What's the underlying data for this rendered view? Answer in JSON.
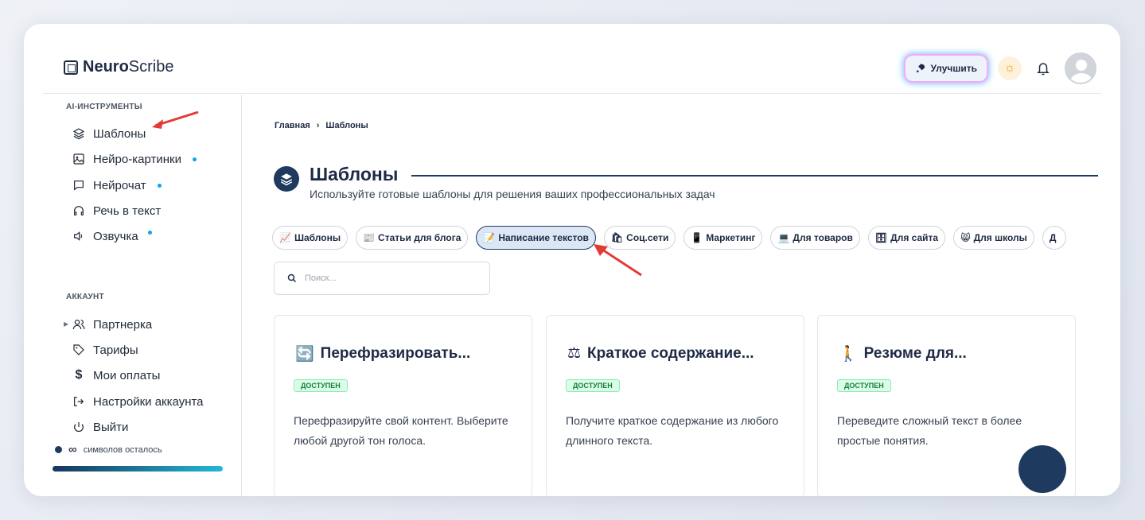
{
  "app": {
    "brand_bold": "Neuro",
    "brand_rest": "Scribe"
  },
  "header": {
    "upgrade_label": "Улучшить"
  },
  "sidebar": {
    "sections": [
      {
        "title": "AI-ИНСТРУМЕНТЫ",
        "items": [
          {
            "label": "Шаблоны",
            "icon": "layers-icon"
          },
          {
            "label": "Нейро-картинки",
            "icon": "image-icon",
            "dot": true
          },
          {
            "label": "Нейрочат",
            "icon": "chat-icon",
            "dot": true
          },
          {
            "label": "Речь в текст",
            "icon": "headphones-icon"
          },
          {
            "label": "Озвучка",
            "icon": "speaker-icon",
            "dot": true
          }
        ]
      },
      {
        "title": "АККАУНТ",
        "items": [
          {
            "label": "Партнерка",
            "icon": "users-icon"
          },
          {
            "label": "Тарифы",
            "icon": "tag-icon"
          },
          {
            "label": "Мои оплаты",
            "icon": "dollar-icon"
          },
          {
            "label": "Настройки аккаунта",
            "icon": "logout-arrow-icon"
          },
          {
            "label": "Выйти",
            "icon": "power-icon"
          }
        ]
      }
    ],
    "chars_infinity": "∞",
    "chars_label": "символов осталось"
  },
  "main": {
    "breadcrumb": [
      "Главная",
      "Шаблоны"
    ],
    "title": "Шаблоны",
    "subtitle": "Используйте готовые шаблоны для решения ваших профессиональных задач",
    "chips": [
      {
        "emoji": "📈",
        "label": "Шаблоны"
      },
      {
        "emoji": "📰",
        "label": "Статьи для блога"
      },
      {
        "emoji": "📝",
        "label": "Написание текстов",
        "active": true
      },
      {
        "emoji": "🛍",
        "label": "Соц.сети"
      },
      {
        "emoji": "📱",
        "label": "Маркетинг"
      },
      {
        "emoji": "💻",
        "label": "Для товаров"
      },
      {
        "emoji": "🗄",
        "label": "Для сайта"
      },
      {
        "emoji": "😸",
        "label": "Для школы"
      },
      {
        "emoji": "Д",
        "label": ""
      }
    ],
    "search_placeholder": "Поиск...",
    "cards": [
      {
        "emoji": "🔄",
        "title": "Перефразировать...",
        "badge": "ДОСТУПЕН",
        "desc": "Перефразируйте свой контент. Выберите любой другой тон голоса."
      },
      {
        "emoji": "⚖",
        "title": "Краткое содержание...",
        "badge": "ДОСТУПЕН",
        "desc": "Получите краткое содержание из любого длинного текста."
      },
      {
        "emoji": "🚶",
        "title": "Резюме для...",
        "badge": "ДОСТУПЕН",
        "desc": "Переведите сложный текст в более простые понятия."
      }
    ]
  }
}
